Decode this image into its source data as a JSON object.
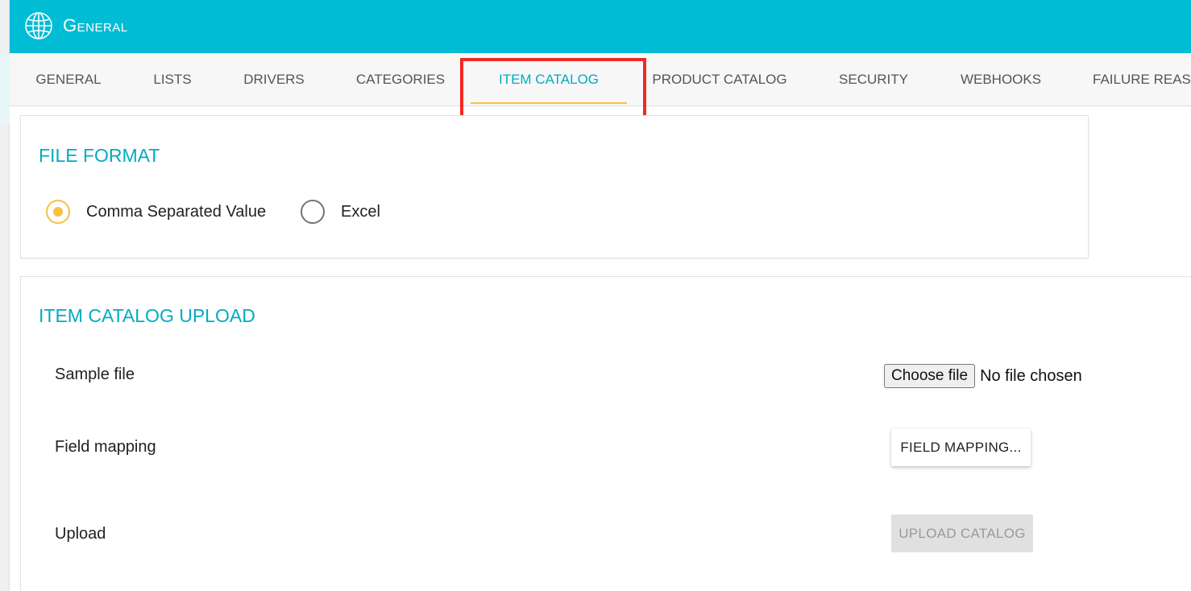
{
  "header": {
    "title": "General",
    "icon": "globe-icon"
  },
  "tabs": [
    {
      "label": "GENERAL",
      "active": false
    },
    {
      "label": "LISTS",
      "active": false
    },
    {
      "label": "DRIVERS",
      "active": false
    },
    {
      "label": "CATEGORIES",
      "active": false
    },
    {
      "label": "ITEM CATALOG",
      "active": true
    },
    {
      "label": "PRODUCT CATALOG",
      "active": false
    },
    {
      "label": "SECURITY",
      "active": false
    },
    {
      "label": "WEBHOOKS",
      "active": false
    },
    {
      "label": "FAILURE REAS",
      "active": false
    }
  ],
  "file_format": {
    "title": "FILE FORMAT",
    "options": [
      {
        "label": "Comma Separated Value",
        "checked": true
      },
      {
        "label": "Excel",
        "checked": false
      }
    ]
  },
  "upload": {
    "title": "ITEM CATALOG UPLOAD",
    "sample_file_label": "Sample file",
    "choose_file_label": "Choose file",
    "no_file_text": "No file chosen",
    "field_mapping_label": "Field mapping",
    "field_mapping_button": "FIELD MAPPING...",
    "upload_label": "Upload",
    "upload_button": "UPLOAD CATALOG",
    "upload_button_disabled": true
  },
  "colors": {
    "header_bg": "#00bcd4",
    "accent": "#00acc1",
    "tab_indicator": "#f5c242",
    "radio_checked": "#f5c242",
    "highlight_box": "#f02a1f"
  }
}
